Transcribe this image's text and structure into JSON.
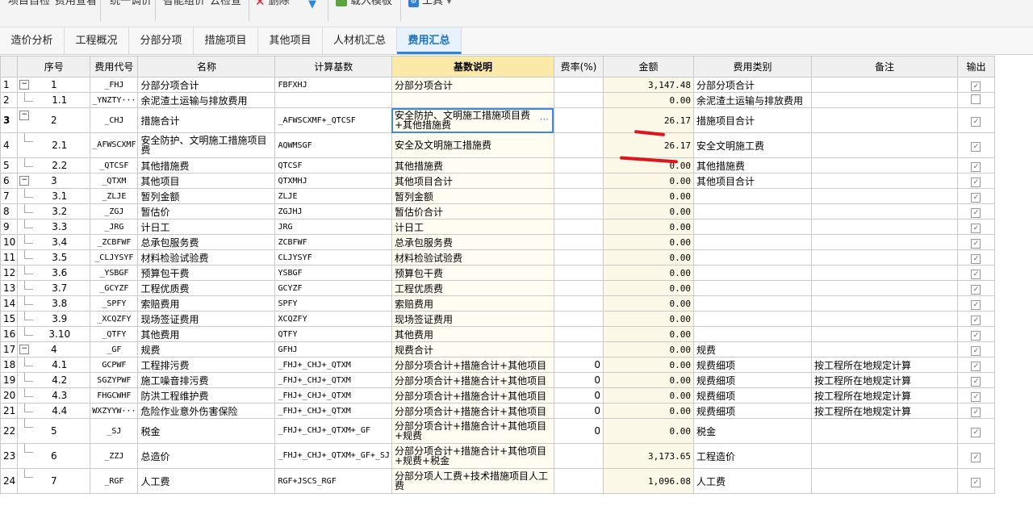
{
  "toolbar": {
    "items": [
      "项目自检",
      "费用查看",
      "统一调价",
      "智能组价",
      "云检查",
      "删除",
      "载入模板",
      "工具"
    ],
    "icons": [
      "delete-icon",
      "down-arrow-icon",
      "import-icon",
      "tool-icon",
      "chevron-down-icon"
    ]
  },
  "tabs": [
    {
      "label": "造价分析",
      "active": false
    },
    {
      "label": "工程概况",
      "active": false
    },
    {
      "label": "分部分项",
      "active": false
    },
    {
      "label": "措施项目",
      "active": false
    },
    {
      "label": "其他项目",
      "active": false
    },
    {
      "label": "人材机汇总",
      "active": false
    },
    {
      "label": "费用汇总",
      "active": true
    }
  ],
  "columns": [
    "序号",
    "费用代号",
    "名称",
    "计算基数",
    "基数说明",
    "费率(%)",
    "金额",
    "费用类别",
    "备注",
    "输出"
  ],
  "rows": [
    {
      "num": "1",
      "tree": "minus",
      "seq": "1",
      "code": "_FHJ",
      "name": "分部分项合计",
      "base": "FBFXHJ",
      "desc": "分部分项合计",
      "rate": "",
      "amount": "3,147.48",
      "cat": "分部分项合计",
      "note": "",
      "out": true
    },
    {
      "num": "2",
      "tree": "",
      "seq": "1.1",
      "code": "_YNZTY···",
      "name": "余泥渣土运输与排放费用",
      "base": "",
      "desc": "",
      "rate": "",
      "amount": "0.00",
      "cat": "余泥渣土运输与排放费用",
      "note": "",
      "out": false
    },
    {
      "num": "3",
      "tree": "minus",
      "seq": "2",
      "code": "_CHJ",
      "name": "措施合计",
      "base": "_AFWSCXMF+_QTCSF",
      "desc": "安全防护、文明施工措施项目费+其他措施费",
      "rate": "",
      "amount": "26.17",
      "cat": "措施项目合计",
      "note": "",
      "out": true
    },
    {
      "num": "4",
      "tree": "",
      "seq": "2.1",
      "code": "_AFWSCXMF",
      "name": "安全防护、文明施工措施项目费",
      "base": "AQWMSGF",
      "desc": "安全及文明施工措施费",
      "rate": "",
      "amount": "26.17",
      "cat": "安全文明施工费",
      "note": "",
      "out": true
    },
    {
      "num": "5",
      "tree": "",
      "seq": "2.2",
      "code": "_QTCSF",
      "name": "其他措施费",
      "base": "QTCSF",
      "desc": "其他措施费",
      "rate": "",
      "amount": "0.00",
      "cat": "其他措施费",
      "note": "",
      "out": true
    },
    {
      "num": "6",
      "tree": "minus",
      "seq": "3",
      "code": "_QTXM",
      "name": "其他项目",
      "base": "QTXMHJ",
      "desc": "其他项目合计",
      "rate": "",
      "amount": "0.00",
      "cat": "其他项目合计",
      "note": "",
      "out": true
    },
    {
      "num": "7",
      "tree": "",
      "seq": "3.1",
      "code": "_ZLJE",
      "name": "暂列金额",
      "base": "ZLJE",
      "desc": "暂列金额",
      "rate": "",
      "amount": "0.00",
      "cat": "",
      "note": "",
      "out": true
    },
    {
      "num": "8",
      "tree": "",
      "seq": "3.2",
      "code": "_ZGJ",
      "name": "暂估价",
      "base": "ZGJHJ",
      "desc": "暂估价合计",
      "rate": "",
      "amount": "0.00",
      "cat": "",
      "note": "",
      "out": true
    },
    {
      "num": "9",
      "tree": "",
      "seq": "3.3",
      "code": "_JRG",
      "name": "计日工",
      "base": "JRG",
      "desc": "计日工",
      "rate": "",
      "amount": "0.00",
      "cat": "",
      "note": "",
      "out": true
    },
    {
      "num": "10",
      "tree": "",
      "seq": "3.4",
      "code": "_ZCBFWF",
      "name": "总承包服务费",
      "base": "ZCBFWF",
      "desc": "总承包服务费",
      "rate": "",
      "amount": "0.00",
      "cat": "",
      "note": "",
      "out": true
    },
    {
      "num": "11",
      "tree": "",
      "seq": "3.5",
      "code": "_CLJYSYF",
      "name": "材料检验试验费",
      "base": "CLJYSYF",
      "desc": "材料检验试验费",
      "rate": "",
      "amount": "0.00",
      "cat": "",
      "note": "",
      "out": true
    },
    {
      "num": "12",
      "tree": "",
      "seq": "3.6",
      "code": "_YSBGF",
      "name": "预算包干费",
      "base": "YSBGF",
      "desc": "预算包干费",
      "rate": "",
      "amount": "0.00",
      "cat": "",
      "note": "",
      "out": true
    },
    {
      "num": "13",
      "tree": "",
      "seq": "3.7",
      "code": "_GCYZF",
      "name": "工程优质费",
      "base": "GCYZF",
      "desc": "工程优质费",
      "rate": "",
      "amount": "0.00",
      "cat": "",
      "note": "",
      "out": true
    },
    {
      "num": "14",
      "tree": "",
      "seq": "3.8",
      "code": "_SPFY",
      "name": "索赔费用",
      "base": "SPFY",
      "desc": "索赔费用",
      "rate": "",
      "amount": "0.00",
      "cat": "",
      "note": "",
      "out": true
    },
    {
      "num": "15",
      "tree": "",
      "seq": "3.9",
      "code": "_XCQZFY",
      "name": "现场签证费用",
      "base": "XCQZFY",
      "desc": "现场签证费用",
      "rate": "",
      "amount": "0.00",
      "cat": "",
      "note": "",
      "out": true
    },
    {
      "num": "16",
      "tree": "",
      "seq": "3.10",
      "code": "_QTFY",
      "name": "其他费用",
      "base": "QTFY",
      "desc": "其他费用",
      "rate": "",
      "amount": "0.00",
      "cat": "",
      "note": "",
      "out": true
    },
    {
      "num": "17",
      "tree": "minus",
      "seq": "4",
      "code": "_GF",
      "name": "规费",
      "base": "GFHJ",
      "desc": "规费合计",
      "rate": "",
      "amount": "0.00",
      "cat": "规费",
      "note": "",
      "out": true
    },
    {
      "num": "18",
      "tree": "",
      "seq": "4.1",
      "code": "GCPWF",
      "name": "工程排污费",
      "base": "_FHJ+_CHJ+_QTXM",
      "desc": "分部分项合计+措施合计+其他项目",
      "rate": "0",
      "amount": "0.00",
      "cat": "规费细项",
      "note": "按工程所在地规定计算",
      "out": true
    },
    {
      "num": "19",
      "tree": "",
      "seq": "4.2",
      "code": "SGZYPWF",
      "name": "施工噪音排污费",
      "base": "_FHJ+_CHJ+_QTXM",
      "desc": "分部分项合计+措施合计+其他项目",
      "rate": "0",
      "amount": "0.00",
      "cat": "规费细项",
      "note": "按工程所在地规定计算",
      "out": true
    },
    {
      "num": "20",
      "tree": "",
      "seq": "4.3",
      "code": "FHGCWHF",
      "name": "防洪工程维护费",
      "base": "_FHJ+_CHJ+_QTXM",
      "desc": "分部分项合计+措施合计+其他项目",
      "rate": "0",
      "amount": "0.00",
      "cat": "规费细项",
      "note": "按工程所在地规定计算",
      "out": true
    },
    {
      "num": "21",
      "tree": "",
      "seq": "4.4",
      "code": "WXZYYW···",
      "name": "危险作业意外伤害保险",
      "base": "_FHJ+_CHJ+_QTXM",
      "desc": "分部分项合计+措施合计+其他项目",
      "rate": "0",
      "amount": "0.00",
      "cat": "规费细项",
      "note": "按工程所在地规定计算",
      "out": true
    },
    {
      "num": "22",
      "tree": "",
      "seq": "5",
      "code": "_SJ",
      "name": "税金",
      "base": "_FHJ+_CHJ+_QTXM+_GF",
      "desc": "分部分项合计+措施合计+其他项目+规费",
      "rate": "0",
      "amount": "0.00",
      "cat": "税金",
      "note": "",
      "out": true
    },
    {
      "num": "23",
      "tree": "",
      "seq": "6",
      "code": "_ZZJ",
      "name": "总造价",
      "base": "_FHJ+_CHJ+_QTXM+_GF+_SJ",
      "desc": "分部分项合计+措施合计+其他项目+规费+税金",
      "rate": "",
      "amount": "3,173.65",
      "cat": "工程造价",
      "note": "",
      "out": true
    },
    {
      "num": "24",
      "tree": "",
      "seq": "7",
      "code": "_RGF",
      "name": "人工费",
      "base": "RGF+JSCS_RGF",
      "desc": "分部分项人工费+技术措施项目人工费",
      "rate": "",
      "amount": "1,096.08",
      "cat": "人工费",
      "note": "",
      "out": true
    }
  ],
  "colors": {
    "accent": "#2c86d8",
    "header_highlight": "#fbe9a7",
    "amount_bg": "#fcf8e8",
    "annotation_red": "#e0141d"
  }
}
